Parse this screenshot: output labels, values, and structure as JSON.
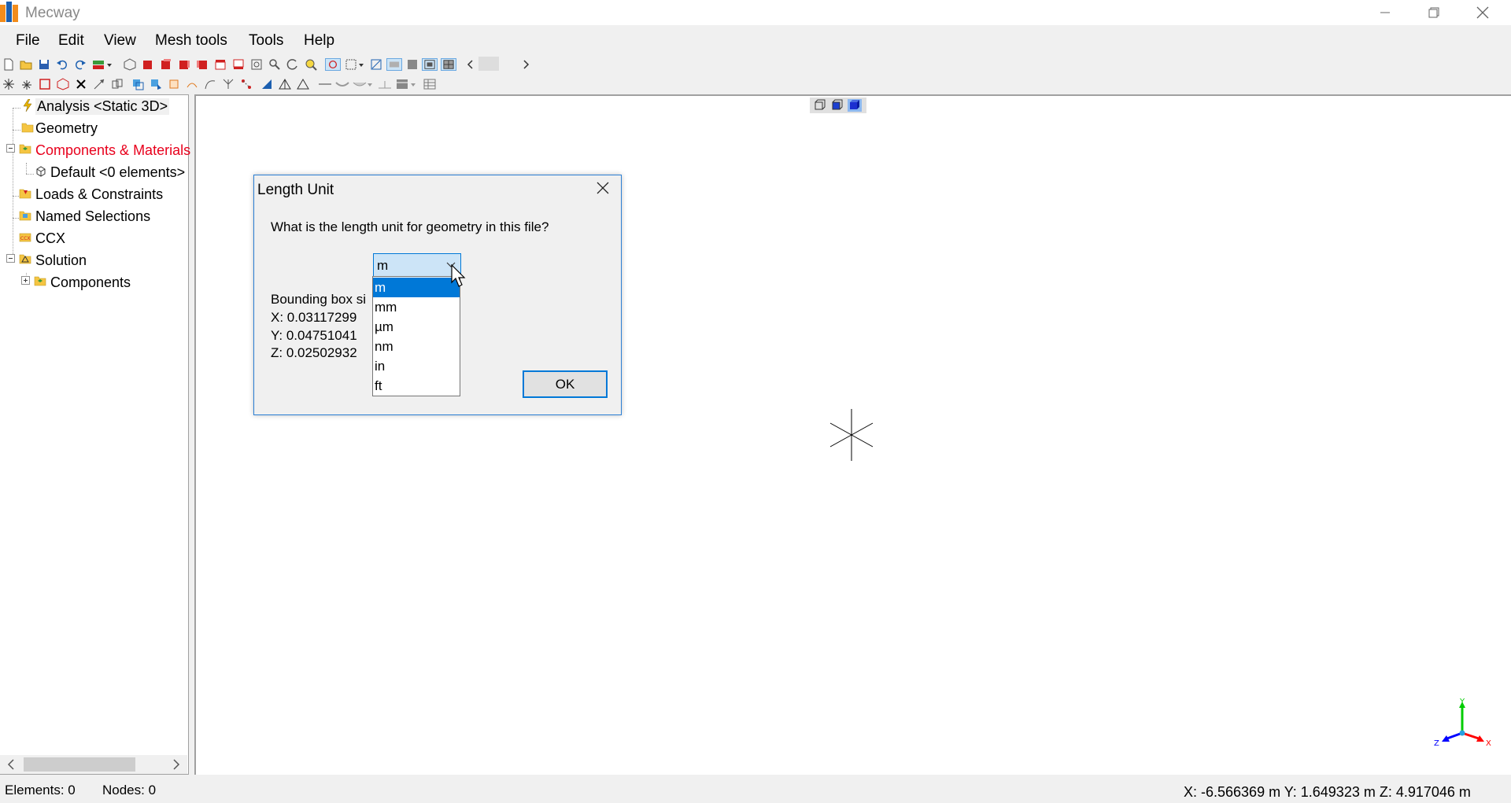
{
  "window": {
    "title": "Mecway"
  },
  "menu": {
    "file": "File",
    "edit": "Edit",
    "view": "View",
    "mesh_tools": "Mesh tools",
    "tools": "Tools",
    "help": "Help"
  },
  "tree": {
    "analysis": "Analysis <Static 3D>",
    "geometry": "Geometry",
    "components_materials": "Components & Materials",
    "default_component": "Default <0 elements>",
    "loads_constraints": "Loads & Constraints",
    "named_selections": "Named Selections",
    "ccx": "CCX",
    "solution": "Solution",
    "solution_components": "Components",
    "error_color": "#e8001c"
  },
  "dialog": {
    "title": "Length Unit",
    "question": "What is the length unit for geometry in this file?",
    "selected_unit": "m",
    "bbox_label": "Bounding box si",
    "bbox_x": "X: 0.03117299",
    "bbox_y": "Y: 0.04751041",
    "bbox_z": "Z: 0.02502932",
    "ok_label": "OK",
    "unit_options": [
      "m",
      "mm",
      "µm",
      "nm",
      "in",
      "ft"
    ],
    "selected_index": 0
  },
  "status": {
    "elements": "Elements:  0",
    "nodes": "Nodes: 0",
    "coords": "X: -6.566369 m Y: 1.649323 m Z: 4.917046 m"
  },
  "triad": {
    "x_label": "X",
    "y_label": "Y",
    "z_label": "Z",
    "x_color": "#ff0000",
    "y_color": "#00cc00",
    "z_color": "#0000ff"
  },
  "colors": {
    "accent": "#0078d7",
    "selection": "#0078d7",
    "combo_bg": "#cce4f7"
  }
}
